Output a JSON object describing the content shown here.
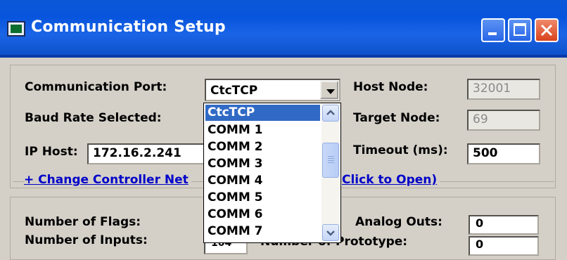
{
  "window": {
    "title": "Communication Setup"
  },
  "form": {
    "comm_port_label": "Communication Port:",
    "comm_port_value": "CtcTCP",
    "baud_label": "Baud Rate Selected:",
    "ip_label": "IP Host:",
    "ip_value": "172.16.2.241",
    "host_node_label": "Host Node:",
    "host_node_value": "32001",
    "target_node_label": "Target Node:",
    "target_node_value": "69",
    "timeout_label": "Timeout (ms):",
    "timeout_value": "500",
    "change_link_left": "+ Change Controller Net",
    "change_link_right": "Click to Open)"
  },
  "dropdown": {
    "options": [
      "CtcTCP",
      "COMM 1",
      "COMM 2",
      "COMM 3",
      "COMM 4",
      "COMM 5",
      "COMM 6",
      "COMM 7"
    ],
    "selected_index": 0
  },
  "stats": {
    "flags_label": "Number of Flags:",
    "inputs_label": "Number of Inputs:",
    "analog_outs_label": "Analog Outs:",
    "analog_outs_value": "0",
    "prototype_label": "Number of Prototype:",
    "prototype_value": "0",
    "inputs_value_partial": "104"
  }
}
